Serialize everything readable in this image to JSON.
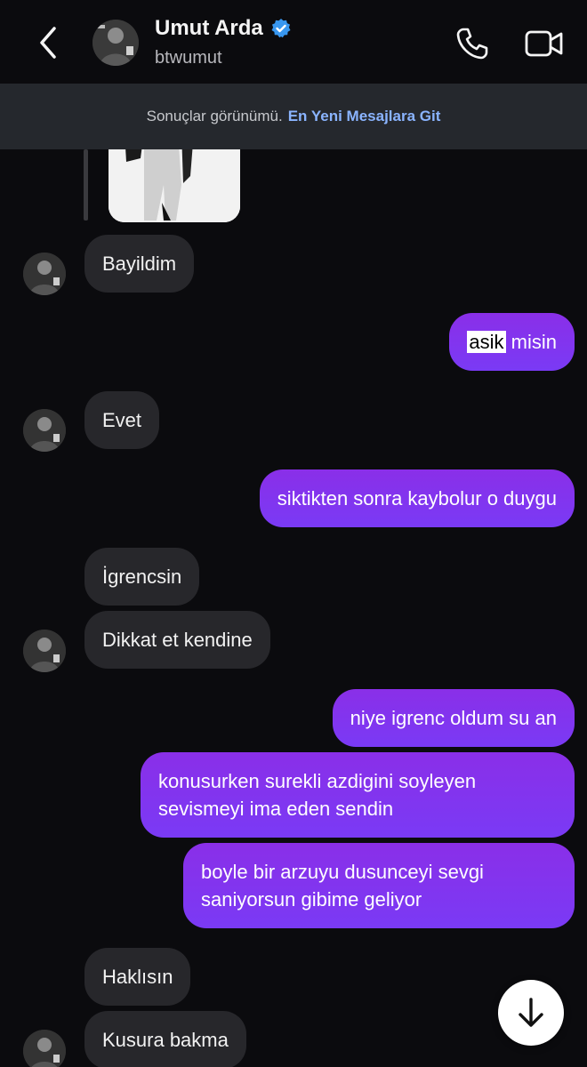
{
  "header": {
    "name": "Umut Arda",
    "handle": "btwumut",
    "verified": true
  },
  "banner": {
    "text": "Sonuçlar görünümü.",
    "link": "En Yeni Mesajlara Git"
  },
  "messages": [
    {
      "from": "them",
      "text": "Bayildim"
    },
    {
      "from": "me",
      "highlight": "asik",
      "rest": " misin"
    },
    {
      "from": "them",
      "text": "Evet"
    },
    {
      "from": "me",
      "text": "siktikten sonra kaybolur o duygu"
    },
    {
      "from": "them",
      "text": "İgrencsin"
    },
    {
      "from": "them",
      "text": "Dikkat et kendine"
    },
    {
      "from": "me",
      "text": "niye igrenc oldum su an"
    },
    {
      "from": "me",
      "text": "konusurken surekli azdigini soyleyen sevismeyi ima eden sendin"
    },
    {
      "from": "me",
      "text": "boyle bir arzuyu dusunceyi sevgi saniyorsun gibime geliyor"
    },
    {
      "from": "them",
      "text": "Haklısın"
    },
    {
      "from": "them",
      "text": "Kusura bakma"
    }
  ],
  "colors": {
    "background": "#0b0b0e",
    "incoming_bubble": "#27272b",
    "outgoing_bubble": "#7b2ff7",
    "banner": "#25282d",
    "link": "#8ab4ff",
    "verified": "#3897f0"
  },
  "icons": {
    "back": "chevron-left-icon",
    "call": "phone-icon",
    "video": "video-camera-icon",
    "verified": "verified-badge-icon",
    "scroll": "arrow-down-icon"
  }
}
